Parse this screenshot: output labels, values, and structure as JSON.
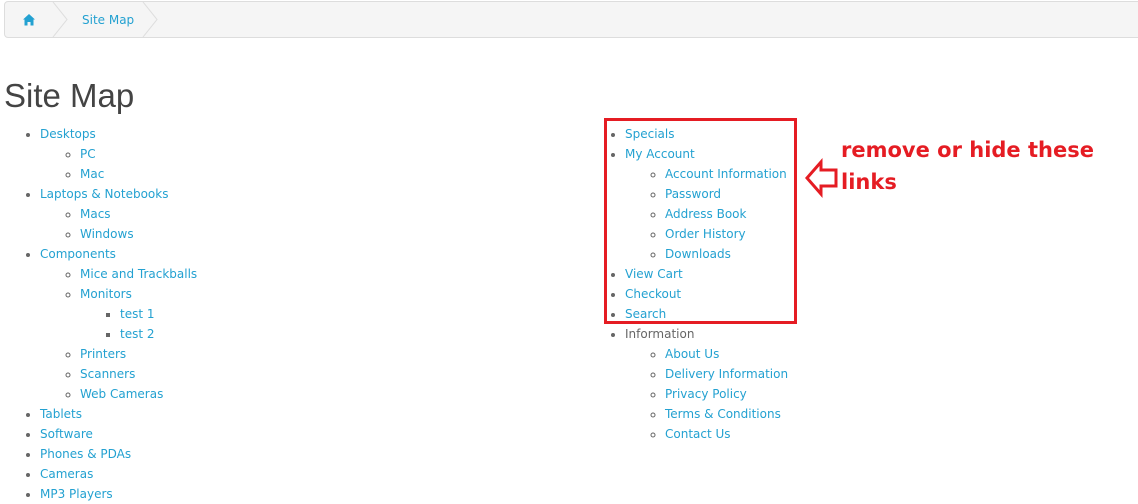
{
  "breadcrumb": {
    "home_icon": "home-icon",
    "current": "Site Map"
  },
  "page_title": "Site Map",
  "left_column": [
    {
      "label": "Desktops",
      "children": [
        {
          "label": "PC"
        },
        {
          "label": "Mac"
        }
      ]
    },
    {
      "label": "Laptops & Notebooks",
      "children": [
        {
          "label": "Macs"
        },
        {
          "label": "Windows"
        }
      ]
    },
    {
      "label": "Components",
      "children": [
        {
          "label": "Mice and Trackballs"
        },
        {
          "label": "Monitors",
          "children": [
            {
              "label": "test 1"
            },
            {
              "label": "test 2"
            }
          ]
        },
        {
          "label": "Printers"
        },
        {
          "label": "Scanners"
        },
        {
          "label": "Web Cameras"
        }
      ]
    },
    {
      "label": "Tablets"
    },
    {
      "label": "Software"
    },
    {
      "label": "Phones & PDAs"
    },
    {
      "label": "Cameras"
    },
    {
      "label": "MP3 Players"
    }
  ],
  "right_column": [
    {
      "label": "Specials"
    },
    {
      "label": "My Account",
      "children": [
        {
          "label": "Account Information"
        },
        {
          "label": "Password"
        },
        {
          "label": "Address Book"
        },
        {
          "label": "Order History"
        },
        {
          "label": "Downloads"
        }
      ]
    },
    {
      "label": "View Cart"
    },
    {
      "label": "Checkout"
    },
    {
      "label": "Search"
    },
    {
      "label": "Information",
      "plain": true,
      "children": [
        {
          "label": "About Us"
        },
        {
          "label": "Delivery Information"
        },
        {
          "label": "Privacy Policy"
        },
        {
          "label": "Terms & Conditions"
        },
        {
          "label": "Contact Us"
        }
      ]
    }
  ],
  "annotation": {
    "text_line1": "remove or hide these",
    "text_line2": "links",
    "color": "#e51c23"
  },
  "colors": {
    "link": "#23a1d1",
    "text": "#666666",
    "title": "#444444"
  }
}
